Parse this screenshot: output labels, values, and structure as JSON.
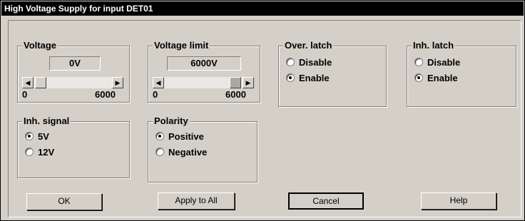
{
  "window": {
    "title": "High Voltage Supply for input DET01"
  },
  "voltage": {
    "label": "Voltage",
    "value": "0V",
    "min_label": "0",
    "max_label": "6000",
    "slider_fraction": 0.0
  },
  "voltage_limit": {
    "label": "Voltage limit",
    "value": "6000V",
    "min_label": "0",
    "max_label": "6000",
    "slider_fraction": 1.0
  },
  "over_latch": {
    "label": "Over. latch",
    "options": [
      "Disable",
      "Enable"
    ],
    "selected": "Enable"
  },
  "inh_latch": {
    "label": "Inh. latch",
    "options": [
      "Disable",
      "Enable"
    ],
    "selected": "Enable"
  },
  "inh_signal": {
    "label": "Inh. signal",
    "options": [
      "5V",
      "12V"
    ],
    "selected": "5V"
  },
  "polarity": {
    "label": "Polarity",
    "options": [
      "Positive",
      "Negative"
    ],
    "selected": "Positive"
  },
  "buttons": {
    "ok": "OK",
    "apply_all": "Apply to All",
    "cancel": "Cancel",
    "help": "Help"
  }
}
